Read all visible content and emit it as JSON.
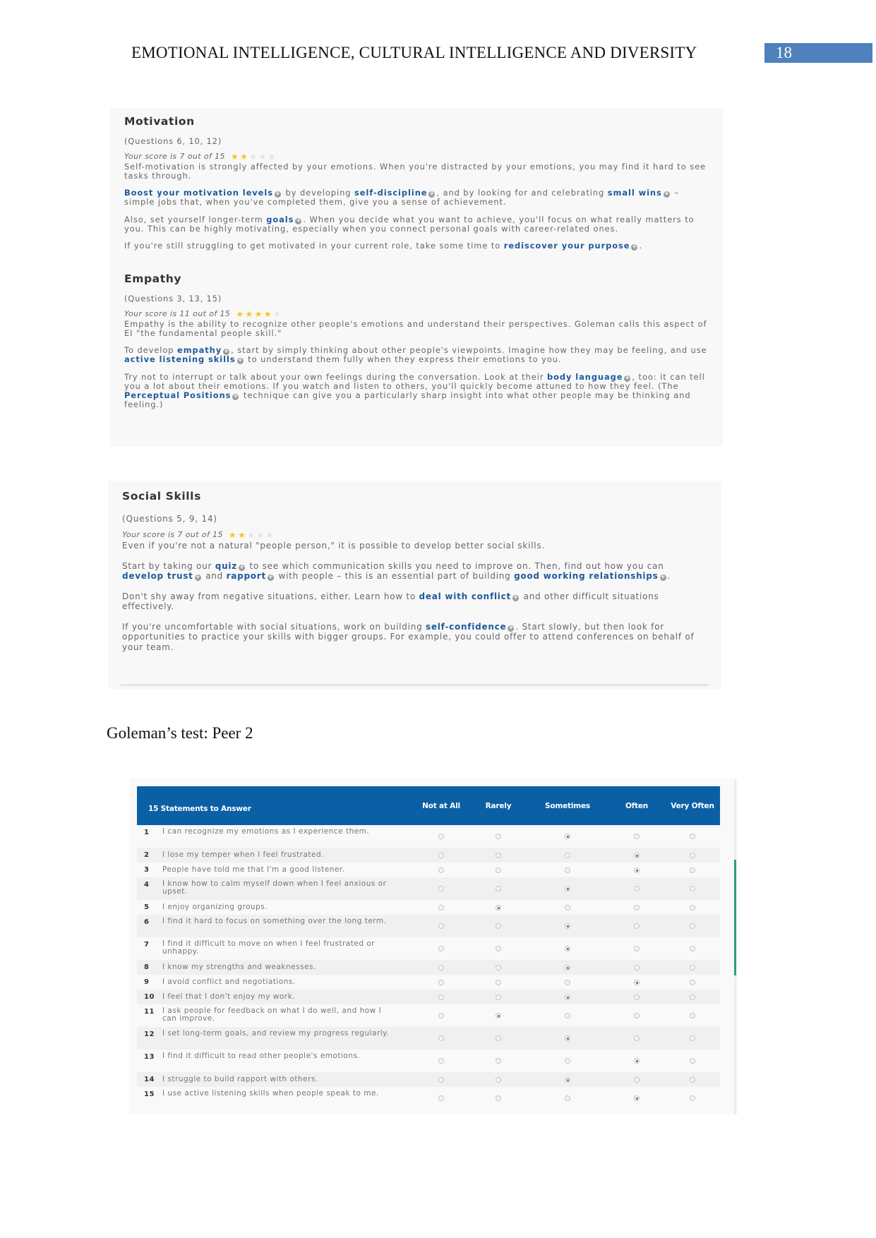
{
  "header": {
    "title": "EMOTIONAL INTELLIGENCE, CULTURAL INTELLIGENCE AND DIVERSITY",
    "page_number": "18",
    "page_box_color": "#4f81bd"
  },
  "sections": [
    {
      "title": "Motivation",
      "questions": "(Questions 6, 10, 12)",
      "score_text": "Your score is 7 out of 15",
      "stars_filled": 2,
      "stars_total": 5,
      "paragraphs": [
        [
          {
            "t": "Self-motivation is strongly affected by your emotions. When you're distracted by your emotions, you may find it hard to see tasks through."
          }
        ],
        [
          {
            "t": "Boost your motivation levels",
            "link": true
          },
          {
            "t": " by developing "
          },
          {
            "t": "self-discipline",
            "link": true
          },
          {
            "t": ", and by looking for and celebrating "
          },
          {
            "t": "small wins",
            "link": true
          },
          {
            "t": " – simple jobs that, when you've completed them, give you a sense of achievement."
          }
        ],
        [
          {
            "t": "Also, set yourself longer-term "
          },
          {
            "t": "goals",
            "link": true
          },
          {
            "t": ". When you decide what you want to achieve, you'll focus on what really matters to you. This can be highly motivating, especially when you connect personal goals with career-related ones."
          }
        ],
        [
          {
            "t": "If you're still struggling to get motivated in your current role, take some time to "
          },
          {
            "t": "rediscover your purpose",
            "link": true
          },
          {
            "t": "."
          }
        ]
      ]
    },
    {
      "title": "Empathy",
      "questions": "(Questions 3, 13, 15)",
      "score_text": "Your score is 11 out of 15",
      "stars_filled": 4,
      "stars_total": 5,
      "paragraphs": [
        [
          {
            "t": "Empathy is the ability to recognize other people's emotions and understand their perspectives. Goleman calls this aspect of EI \"the fundamental people skill.\""
          }
        ],
        [
          {
            "t": "To develop "
          },
          {
            "t": "empathy",
            "link": true
          },
          {
            "t": ", start by simply thinking about other people's viewpoints. Imagine how they may be feeling, and use "
          },
          {
            "t": "active listening skills",
            "link": true
          },
          {
            "t": " to understand them fully when they express their emotions to you."
          }
        ],
        [
          {
            "t": "Try not to interrupt or talk about your own feelings during the conversation. Look at their "
          },
          {
            "t": "body language",
            "link": true
          },
          {
            "t": ", too: it can tell you a lot about their emotions. If you watch and listen to others, you'll quickly become attuned to how they feel. (The "
          },
          {
            "t": "Perceptual Positions",
            "link": true
          },
          {
            "t": " technique can give you a particularly sharp insight into what other people may be thinking and feeling.)"
          }
        ]
      ]
    },
    {
      "title": "Social Skills",
      "questions": "(Questions 5, 9, 14)",
      "score_text": "Your score is 7 out of 15",
      "stars_filled": 2,
      "stars_total": 5,
      "paragraphs": [
        [
          {
            "t": "Even if you're not a natural \"people person,\" it is possible to develop better social skills."
          }
        ],
        [
          {
            "t": "Start by taking our "
          },
          {
            "t": "quiz",
            "link": true
          },
          {
            "t": " to see which communication skills you need to improve on. Then, find out how you can "
          },
          {
            "t": "develop trust",
            "link": true
          },
          {
            "t": " and "
          },
          {
            "t": "rapport",
            "link": true
          },
          {
            "t": " with people – this is an essential part of building "
          },
          {
            "t": "good working relationships",
            "link": true
          },
          {
            "t": "."
          }
        ],
        [
          {
            "t": "Don't shy away from negative situations, either. Learn how to "
          },
          {
            "t": "deal with conflict",
            "link": true
          },
          {
            "t": " and other difficult situations effectively."
          }
        ],
        [
          {
            "t": "If you're uncomfortable with social situations, work on building "
          },
          {
            "t": "self-confidence",
            "link": true
          },
          {
            "t": ". Start slowly, but then look for opportunities to practice your skills with bigger groups. For example, you could offer to attend conferences on behalf of your team."
          }
        ]
      ]
    }
  ],
  "caption": "Goleman’s test: Peer 2",
  "table": {
    "header_color": "#0b5fa4",
    "title": "15 Statements to Answer",
    "columns": [
      "Not at All",
      "Rarely",
      "Sometimes",
      "Often",
      "Very Often"
    ],
    "rows": [
      {
        "n": "1",
        "text": "I can recognize my emotions as I experience them.",
        "answer": "Sometimes"
      },
      {
        "n": "2",
        "text": "I lose my temper when I feel frustrated.",
        "answer": "Often"
      },
      {
        "n": "3",
        "text": "People have told me that I'm a good listener.",
        "answer": "Often"
      },
      {
        "n": "4",
        "text": "I know how to calm myself down when I feel anxious or upset.",
        "answer": "Sometimes"
      },
      {
        "n": "5",
        "text": "I enjoy organizing groups.",
        "answer": "Rarely"
      },
      {
        "n": "6",
        "text": "I find it hard to focus on something over the long term.",
        "answer": "Sometimes"
      },
      {
        "n": "7",
        "text": "I find it difficult to move on when I feel frustrated or unhappy.",
        "answer": "Sometimes"
      },
      {
        "n": "8",
        "text": "I know my strengths and weaknesses.",
        "answer": "Sometimes"
      },
      {
        "n": "9",
        "text": "I avoid conflict and negotiations.",
        "answer": "Often"
      },
      {
        "n": "10",
        "text": "I feel that I don't enjoy my work.",
        "answer": "Sometimes"
      },
      {
        "n": "11",
        "text": "I ask people for feedback on what I do well, and how I can improve.",
        "answer": "Rarely"
      },
      {
        "n": "12",
        "text": "I set long-term goals, and review my progress regularly.",
        "answer": "Sometimes"
      },
      {
        "n": "13",
        "text": "I find it difficult to read other people's emotions.",
        "answer": "Often"
      },
      {
        "n": "14",
        "text": "I struggle to build rapport with others.",
        "answer": "Sometimes"
      },
      {
        "n": "15",
        "text": "I use active listening skills when people speak to me.",
        "answer": "Often"
      }
    ]
  }
}
